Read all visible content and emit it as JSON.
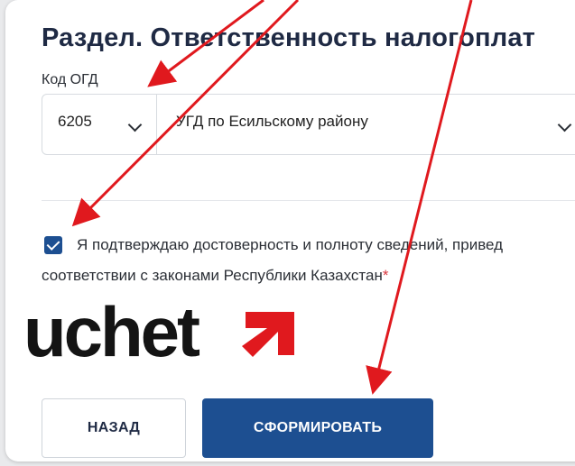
{
  "section": {
    "title": "Раздел. Ответственность налогоплат"
  },
  "ogd": {
    "label": "Код ОГД",
    "code_value": "6205",
    "name_value": "УГД по Есильскому району"
  },
  "confirmation": {
    "line1": "Я подтверждаю достоверность и полноту сведений, привед",
    "line2": "соответствии с законами Республики Казахстан",
    "required_mark": "*",
    "checked": true
  },
  "watermark": {
    "text": "uchet"
  },
  "buttons": {
    "back_label": "НАЗАД",
    "submit_label": "СФОРМИРОВАТЬ"
  },
  "colors": {
    "primary": "#1d4f91",
    "annotation_arrow": "#e0191e",
    "required": "#d9363e"
  }
}
